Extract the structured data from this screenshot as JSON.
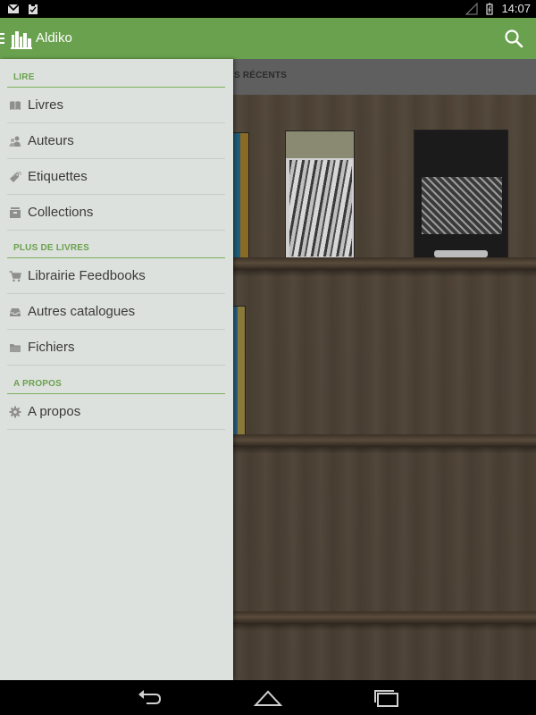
{
  "status_bar": {
    "left_icons": [
      "gmail-icon",
      "clipboard-icon"
    ],
    "right_icons": [
      "signal-icon",
      "battery-icon"
    ],
    "time": "14:07"
  },
  "action_bar": {
    "title": "Aldiko",
    "icons": [
      "drawer-indicator-icon",
      "aldiko-logo-icon",
      "search-icon"
    ]
  },
  "tab": {
    "label": "S RÉCENTS"
  },
  "drawer": {
    "sections": [
      {
        "title": "LIRE",
        "items": [
          {
            "label": "Livres",
            "icon": "book-icon"
          },
          {
            "label": "Auteurs",
            "icon": "people-icon"
          },
          {
            "label": "Etiquettes",
            "icon": "tag-icon"
          },
          {
            "label": "Collections",
            "icon": "collection-icon"
          }
        ]
      },
      {
        "title": "PLUS DE LIVRES",
        "items": [
          {
            "label": "Librairie Feedbooks",
            "icon": "cart-icon"
          },
          {
            "label": "Autres catalogues",
            "icon": "tray-icon"
          },
          {
            "label": "Fichiers",
            "icon": "folder-icon"
          }
        ]
      },
      {
        "title": "A PROPOS",
        "items": [
          {
            "label": "A propos",
            "icon": "gear-icon"
          }
        ]
      }
    ]
  },
  "colors": {
    "accent": "#6aa14e",
    "drawer_bg": "#dde1dd",
    "item_text": "#3a3a3a"
  },
  "nav_bar": {
    "buttons": [
      "back-icon",
      "home-icon",
      "recents-icon"
    ]
  }
}
